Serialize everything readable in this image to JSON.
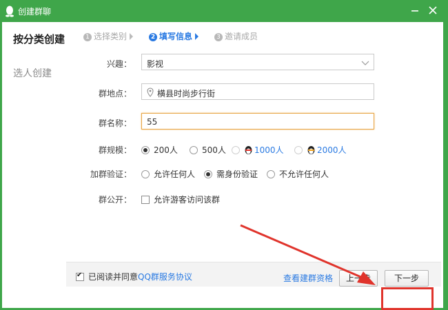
{
  "window": {
    "title": "创建群聊"
  },
  "sidebar": {
    "items": [
      {
        "label": "按分类创建",
        "active": true
      },
      {
        "label": "选人创建",
        "active": false
      }
    ]
  },
  "steps": [
    {
      "num": "1",
      "label": "选择类别",
      "active": false
    },
    {
      "num": "2",
      "label": "填写信息",
      "active": true
    },
    {
      "num": "3",
      "label": "邀请成员",
      "active": false
    }
  ],
  "form": {
    "interest": {
      "label": "兴趣：",
      "value": "影视"
    },
    "location": {
      "label": "群地点：",
      "value": "横县时尚步行街"
    },
    "name": {
      "label": "群名称：",
      "value": "55"
    },
    "scale": {
      "label": "群规模：",
      "options": [
        "200人",
        "500人",
        "1000人",
        "2000人"
      ],
      "selected": "200人"
    },
    "verify": {
      "label": "加群验证：",
      "options": [
        "允许任何人",
        "需身份验证",
        "不允许任何人"
      ],
      "selected": "需身份验证"
    },
    "public": {
      "label": "群公开：",
      "checkbox_label": "允许游客访问该群",
      "checked": false
    }
  },
  "footer": {
    "agree_prefix": "已阅读并同意",
    "agree_link": "QQ群服务协议",
    "agree_checked": true,
    "qualification_link": "查看建群资格",
    "prev_button": "上一步",
    "next_button": "下一步"
  },
  "colors": {
    "title_bar": "#3fa64a",
    "link": "#2a7ae2",
    "highlight": "#e0342c"
  }
}
